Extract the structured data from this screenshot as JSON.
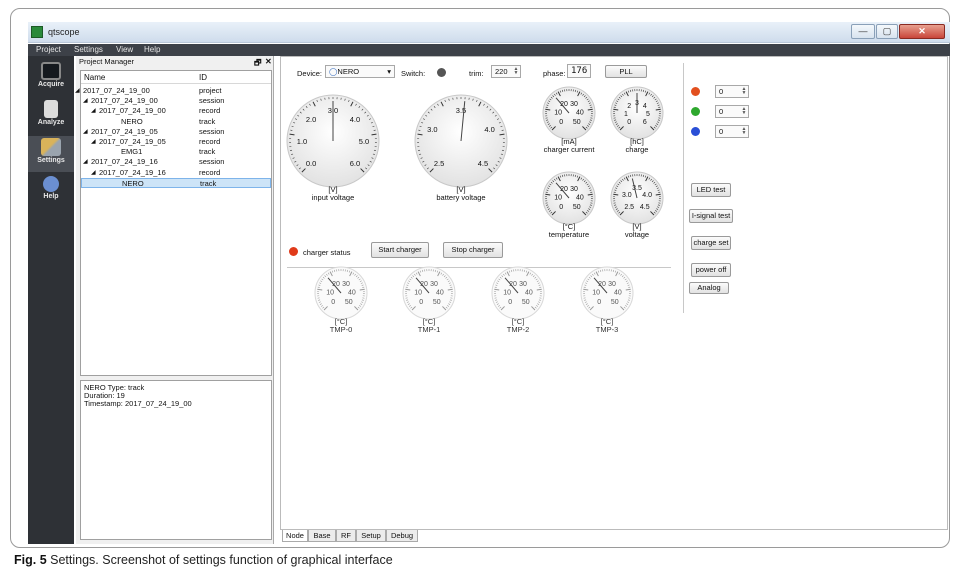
{
  "window": {
    "title": "qtscope",
    "minimize": "—",
    "maximize": "▢",
    "close": "✕"
  },
  "menu": [
    "Project",
    "Settings",
    "View",
    "Help"
  ],
  "rail": [
    {
      "label": "Acquire",
      "icon": "monitor-icon"
    },
    {
      "label": "Analyze",
      "icon": "document-icon"
    },
    {
      "label": "Settings",
      "icon": "tools-icon"
    },
    {
      "label": "Help",
      "icon": "help-icon"
    }
  ],
  "project_manager": {
    "title": "Project Manager",
    "restore": "🗗",
    "close": "✕",
    "col_name": "Name",
    "col_id": "ID",
    "rows": [
      {
        "arrow": "◢",
        "name": "2017_07_24_19_00",
        "id": "project"
      },
      {
        "arrow": "◢",
        "name": "2017_07_24_19_00",
        "id": "session"
      },
      {
        "arrow": "◢",
        "name": "2017_07_24_19_00",
        "id": "record"
      },
      {
        "arrow": "",
        "name": "NERO",
        "id": "track"
      },
      {
        "arrow": "◢",
        "name": "2017_07_24_19_05",
        "id": "session"
      },
      {
        "arrow": "◢",
        "name": "2017_07_24_19_05",
        "id": "record"
      },
      {
        "arrow": "",
        "name": "EMG1",
        "id": "track"
      },
      {
        "arrow": "◢",
        "name": "2017_07_24_19_16",
        "id": "session"
      },
      {
        "arrow": "◢",
        "name": "2017_07_24_19_16",
        "id": "record"
      },
      {
        "arrow": "",
        "name": "NERO",
        "id": "track"
      }
    ],
    "info": [
      "NERO  Type: track",
      "Duration: 19",
      "Timestamp: 2017_07_24_19_00"
    ]
  },
  "toolbar": {
    "device_label": "Device:",
    "device_value": "NERO",
    "switch_label": "Switch:",
    "trim_label": "trim:",
    "trim_value": "220",
    "phase_label": "phase:",
    "phase_value": "176",
    "pll_button": "PLL"
  },
  "gauges_large": [
    {
      "ticks": [
        "0.0",
        "1.0",
        "2.0",
        "3.0",
        "4.0",
        "5.0",
        "6.0"
      ],
      "unit": "[V]",
      "name": "input voltage"
    },
    {
      "ticks": [
        "2.5",
        "3.0",
        "3.5",
        "4.0",
        "4.5"
      ],
      "unit": "[V]",
      "name": "battery voltage"
    }
  ],
  "gauges_small": [
    {
      "ticks": [
        "0",
        "10",
        "20",
        "30",
        "40",
        "50"
      ],
      "unit": "[mA]",
      "name": "charger current"
    },
    {
      "ticks": [
        "0",
        "1",
        "2",
        "3",
        "4",
        "5",
        "6"
      ],
      "unit": "[hC]",
      "name": "charge"
    },
    {
      "ticks": [
        "0",
        "10",
        "20",
        "30",
        "40",
        "50"
      ],
      "unit": "[°C]",
      "name": "temperature"
    },
    {
      "ticks": [
        "2.5",
        "3.0",
        "3.5",
        "4.0",
        "4.5"
      ],
      "unit": "[V]",
      "name": "voltage"
    }
  ],
  "gauges_tmp": [
    {
      "ticks": [
        "0",
        "10",
        "20",
        "30",
        "40",
        "50"
      ],
      "unit": "[°C]",
      "name": "TMP-0"
    },
    {
      "ticks": [
        "0",
        "10",
        "20",
        "30",
        "40",
        "50"
      ],
      "unit": "[°C]",
      "name": "TMP-1"
    },
    {
      "ticks": [
        "0",
        "10",
        "20",
        "30",
        "40",
        "50"
      ],
      "unit": "[°C]",
      "name": "TMP-2"
    },
    {
      "ticks": [
        "0",
        "10",
        "20",
        "30",
        "40",
        "50"
      ],
      "unit": "[°C]",
      "name": "TMP-3"
    }
  ],
  "charger": {
    "status_label": "charger status",
    "start_button": "Start charger",
    "stop_button": "Stop charger",
    "status_color": "#e03a1a"
  },
  "led_panel": {
    "leds": [
      {
        "color": "#e2501f",
        "value": "0"
      },
      {
        "color": "#2ea82e",
        "value": "0"
      },
      {
        "color": "#2a4fd6",
        "value": "0"
      }
    ],
    "led_test": "LED test",
    "isignal_test": "I-signal test",
    "charge_set": "charge set",
    "power_off": "power off",
    "analog": "Analog"
  },
  "tabs": [
    "Node",
    "Base",
    "RF",
    "Setup",
    "Debug"
  ],
  "caption": {
    "fig": "Fig. 5",
    "text": "  Settings. Screenshot of settings function of graphical interface"
  }
}
